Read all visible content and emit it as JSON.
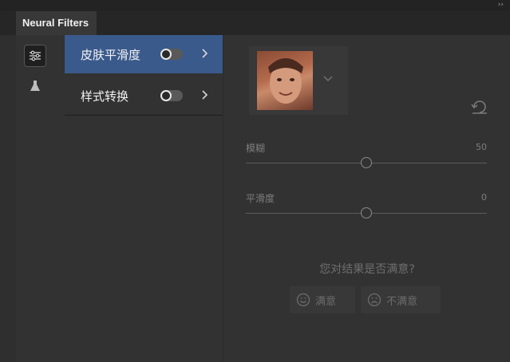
{
  "window": {
    "collapse_glyph": "››",
    "tab_title": "Neural Filters"
  },
  "toolstrip": {
    "tools": [
      {
        "icon": "sliders-icon",
        "active": true
      },
      {
        "icon": "flask-icon",
        "active": false
      }
    ]
  },
  "filters": [
    {
      "label": "皮肤平滑度",
      "enabled": false,
      "selected": true
    },
    {
      "label": "样式转换",
      "enabled": false,
      "selected": false
    }
  ],
  "preview": {
    "thumbnail_icon": "face-thumbnail",
    "dropdown_icon": "chevron-down-icon",
    "reset_icon": "reset-icon"
  },
  "sliders": [
    {
      "label": "模糊",
      "value": "50",
      "fraction": 0.5
    },
    {
      "label": "平滑度",
      "value": "0",
      "fraction": 0.5
    }
  ],
  "feedback": {
    "question": "您对结果是否满意?",
    "satisfied_label": "满意",
    "unsatisfied_label": "不满意"
  },
  "colors": {
    "selected_bg": "#3a5a8c",
    "panel_bg": "#323232"
  }
}
